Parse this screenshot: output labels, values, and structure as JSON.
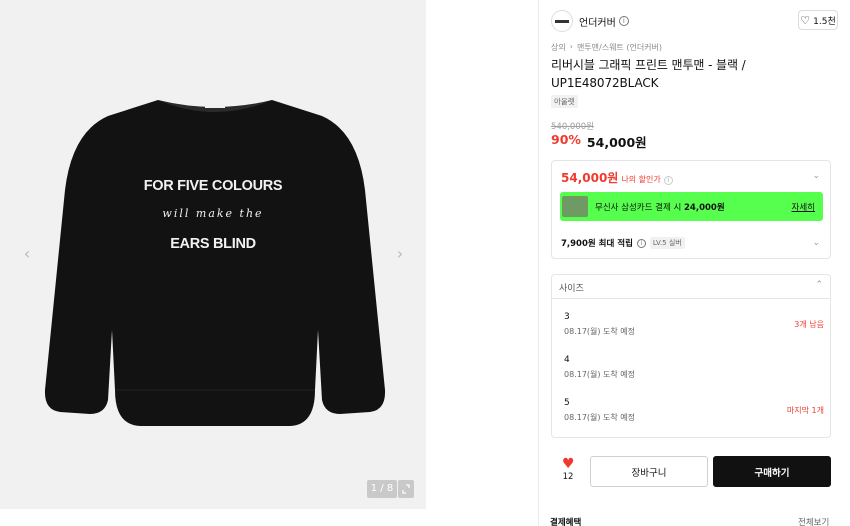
{
  "gallery": {
    "counter": "1 / 8",
    "prev_icon": "chevron-left-icon",
    "next_icon": "chevron-right-icon",
    "expand_icon": "expand-icon",
    "print_lines": [
      "FOR FIVE COLOURS",
      "will make the",
      "EARS BLIND"
    ]
  },
  "brand": {
    "name": "언더커버",
    "logo_icon": "brand-logo"
  },
  "like": {
    "count_label": "1.5천",
    "icon": "heart-outline-icon"
  },
  "breadcrumb": [
    "상의",
    "맨투맨/스웨트 (언더커버)"
  ],
  "product": {
    "title": "리버시블 그래픽 프린트 맨투맨 - 블랙 / UP1E48072BLACK",
    "tag": "아울렛",
    "original_price": "540,000원",
    "discount": "90%",
    "price": "54,000원"
  },
  "my_price": {
    "amount": "54,000원",
    "label": "나의 할인가"
  },
  "promo": {
    "prefix": "무신사 삼성카드 결제 시 ",
    "amount": "24,000원",
    "link": "자세히"
  },
  "points": {
    "amount": "7,900원 최대 적립",
    "level": "LV.5 실버"
  },
  "size": {
    "label": "사이즈",
    "options": [
      {
        "size": "3",
        "eta": "08.17(월) 도착 예정",
        "stock": "3개 남음"
      },
      {
        "size": "4",
        "eta": "08.17(월) 도착 예정",
        "stock": ""
      },
      {
        "size": "5",
        "eta": "08.17(월) 도착 예정",
        "stock": "마지막 1개"
      }
    ]
  },
  "actions": {
    "like_count": "12",
    "cart": "장바구니",
    "buy": "구매하기"
  },
  "footer": {
    "benefits": "결제혜택",
    "view_all": "전체보기"
  },
  "colors": {
    "accent_red": "#f03a2e",
    "promo_green": "#56ff4d",
    "buy_bg": "#111111"
  }
}
